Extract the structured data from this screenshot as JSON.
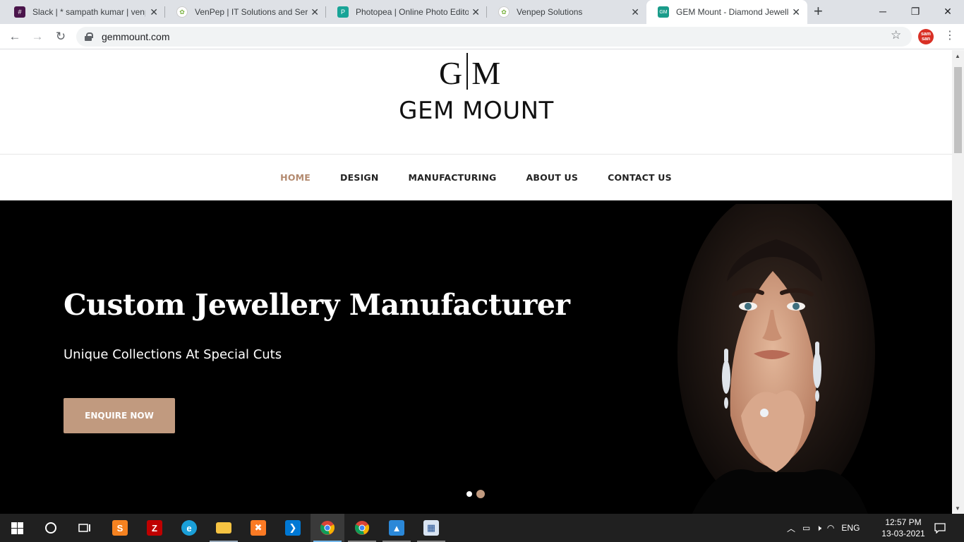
{
  "browser": {
    "tabs": [
      {
        "title": "Slack | * sampath kumar | venp",
        "favicon_color": "#4a154b",
        "favicon_glyph": "#"
      },
      {
        "title": "VenPep | IT Solutions and Servi",
        "favicon_color": "#e8eaed",
        "favicon_glyph": "✿"
      },
      {
        "title": "Photopea | Online Photo Editor",
        "favicon_color": "#18a497",
        "favicon_glyph": "P"
      },
      {
        "title": "Venpep Solutions",
        "favicon_color": "#e8eaed",
        "favicon_glyph": "✿"
      },
      {
        "title": "GEM Mount - Diamond Jewelle",
        "favicon_color": "#1a9c8a",
        "favicon_glyph": "GM"
      }
    ],
    "url": "gemmount.com",
    "profile_label": "sam san"
  },
  "site": {
    "logo_mark_left": "G",
    "logo_mark_right": "M",
    "logo_text": "GEM MOUNT",
    "nav": [
      {
        "label": "HOME",
        "active": true
      },
      {
        "label": "DESIGN",
        "active": false
      },
      {
        "label": "MANUFACTURING",
        "active": false
      },
      {
        "label": "ABOUT US",
        "active": false
      },
      {
        "label": "CONTACT US",
        "active": false
      }
    ],
    "hero": {
      "title": "Custom Jewellery Manufacturer",
      "subtitle": "Unique Collections At Special Cuts",
      "button": "ENQUIRE NOW",
      "slide_count": 2,
      "active_slide": 2
    },
    "accent_color": "#c19a7f"
  },
  "taskbar": {
    "apps": [
      "start-icon",
      "cortana-icon",
      "task-view-icon",
      "sublime-text-icon",
      "filezilla-icon",
      "edge-icon",
      "file-explorer-icon",
      "xampp-icon",
      "vscode-icon",
      "chrome-icon",
      "chrome-icon",
      "photos-icon",
      "paint-icon"
    ],
    "tray_language": "ENG",
    "time": "12:57 PM",
    "date": "13-03-2021"
  }
}
